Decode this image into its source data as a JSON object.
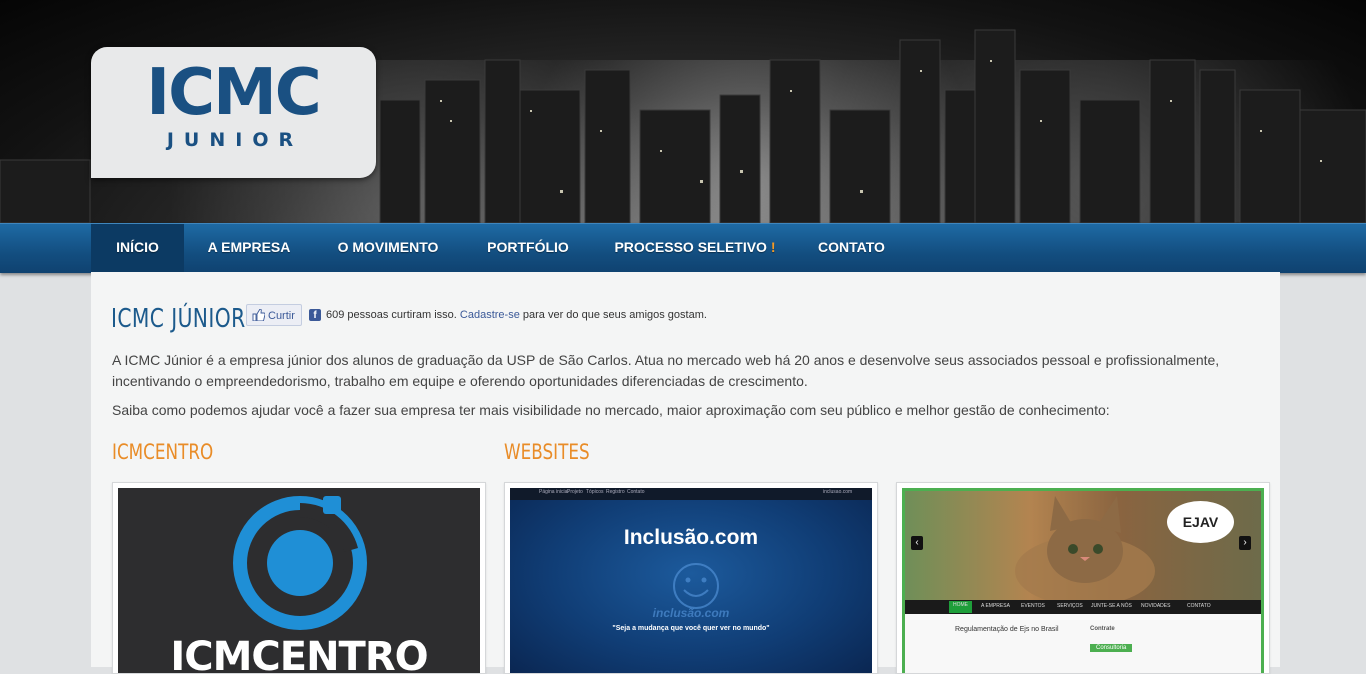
{
  "header": {
    "logo_main": "ICMC",
    "logo_sub": "JUNIOR"
  },
  "nav": {
    "items": [
      {
        "label": "INÍCIO",
        "active": true
      },
      {
        "label": "A EMPRESA"
      },
      {
        "label": "O MOVIMENTO"
      },
      {
        "label": "PORTFÓLIO"
      },
      {
        "label": "PROCESSO SELETIVO",
        "suffix": "!"
      },
      {
        "label": "CONTATO"
      }
    ]
  },
  "main": {
    "title": "ICMC JÚNIOR",
    "like": {
      "button_label": "Curtir",
      "count_text": "609 pessoas curtiram isso.",
      "signup_link": "Cadastre-se",
      "suffix_text": "para ver do que seus amigos gostam."
    },
    "intro": "A ICMC Júnior é a empresa júnior dos alunos de graduação da USP de São Carlos. Atua no mercado web há 20 anos e desenvolve seus associados pessoal e profissionalmente, incentivando o empreendedorismo, trabalho em equipe e oferendo oportunidades diferenciadas de crescimento.",
    "cta": "Saiba como podemos ajudar você a fazer sua empresa ter mais visibilidade no mercado, maior aproximação com seu público e melhor gestão de conhecimento:",
    "sections": [
      {
        "title": "ICMCENTRO"
      },
      {
        "title": "WEBSITES"
      }
    ],
    "cards": [
      {
        "brand": "ICMCENTRO"
      },
      {
        "title": "Inclusão.com",
        "logo_text": "inclusão.com",
        "quote": "\"Seja a mudança que você quer ver no mundo\"",
        "nav": [
          "Página inicial",
          "Projeto",
          "Tópicos",
          "Registro",
          "Contato"
        ],
        "domain": "inclusao.com"
      },
      {
        "badge": "EJAV",
        "nav": [
          "HOME",
          "A EMPRESA",
          "EVENTOS",
          "SERVIÇOS",
          "JUNTE-SE A NÓS",
          "NOVIDADES",
          "CONTATO"
        ],
        "news_heading": "Regulamentação de Ejs no Brasil",
        "sidebar_heading": "Contrate",
        "sidebar_item": "Consultoria"
      }
    ]
  },
  "colors": {
    "nav_bg": "#134e80",
    "title_blue": "#1c5a8c",
    "section_orange": "#e98c27",
    "logo_blue": "#1a5082"
  }
}
